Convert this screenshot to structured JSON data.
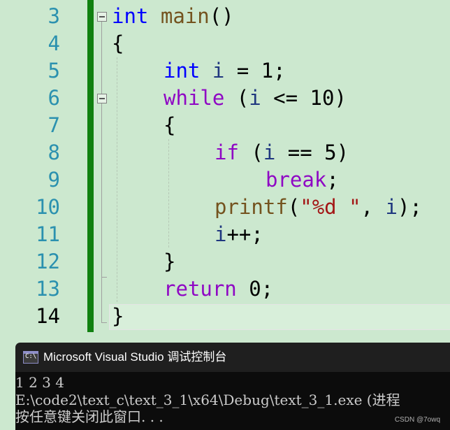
{
  "editor": {
    "line_numbers": [
      "3",
      "4",
      "5",
      "6",
      "7",
      "8",
      "9",
      "10",
      "11",
      "12",
      "13",
      "14"
    ],
    "code": {
      "l3": {
        "type": "int",
        "name": "main",
        "paren": "()"
      },
      "l4": {
        "brace": "{"
      },
      "l5": {
        "type": "int",
        "var": "i",
        "rest": " = 1;"
      },
      "l6": {
        "keyword": "while",
        "open": " (",
        "var": "i",
        "rest": " <= 10)"
      },
      "l7": {
        "brace": "{"
      },
      "l8": {
        "keyword": "if",
        "open": " (",
        "var": "i",
        "rest": " == 5)"
      },
      "l9": {
        "keyword": "break",
        "rest": ";"
      },
      "l10": {
        "fn": "printf",
        "open": "(",
        "str": "\"%d \"",
        "comma": ", ",
        "var": "i",
        "rest": ");"
      },
      "l11": {
        "var": "i",
        "rest": "++;"
      },
      "l12": {
        "brace": "}"
      },
      "l13": {
        "keyword": "return",
        "rest": " 0;"
      },
      "l14": {
        "brace": "}"
      }
    }
  },
  "console": {
    "icon_text": "C:\\",
    "title": "Microsoft Visual Studio 调试控制台",
    "output_lines": [
      "1 2 3 4",
      "E:\\code2\\text_c\\text_3_1\\x64\\Debug\\text_3_1.exe (进程",
      "按任意键关闭此窗口. . ."
    ]
  },
  "watermark": "CSDN @7owq",
  "colors": {
    "editor_background": "#cce8cf",
    "change_bar": "#108010",
    "keyword_blue": "#0000ff",
    "keyword_control_purple": "#8f08c4",
    "function_brown": "#74531f",
    "variable_navy": "#1f377f",
    "string_red": "#a31515",
    "line_number": "#2b91af",
    "console_background": "#0c0c0c",
    "console_title_background": "#1f1f1f"
  }
}
